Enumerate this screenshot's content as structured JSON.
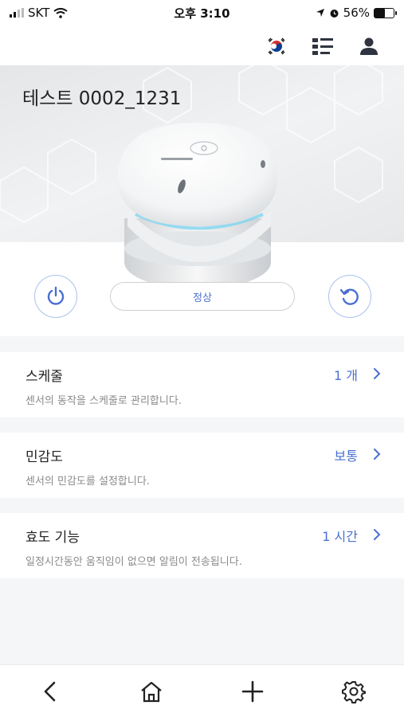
{
  "status_bar": {
    "carrier": "SKT",
    "time": "오후 3:10",
    "battery": "56%",
    "battery_level": 0.56
  },
  "header": {
    "icons": [
      "korea-flag-icon",
      "list-icon",
      "user-icon"
    ]
  },
  "device": {
    "name": "테스트 0002_1231",
    "status": "정상"
  },
  "settings": [
    {
      "title": "스케줄",
      "value": "1 개",
      "description": "센서의 동작을 스케줄로 관리합니다."
    },
    {
      "title": "민감도",
      "value": "보통",
      "description": "센서의 민감도를 설정합니다."
    },
    {
      "title": "효도 기능",
      "value": "1 시간",
      "description": "일정시간동안 움직임이 없으면 알림이 전송됩니다."
    }
  ],
  "tabbar": {
    "icons": [
      "back-icon",
      "home-icon",
      "add-icon",
      "settings-icon"
    ]
  },
  "colors": {
    "accent": "#4a6fd1",
    "button_border": "#a9c1ee",
    "list_background": "#f5f6f7"
  }
}
